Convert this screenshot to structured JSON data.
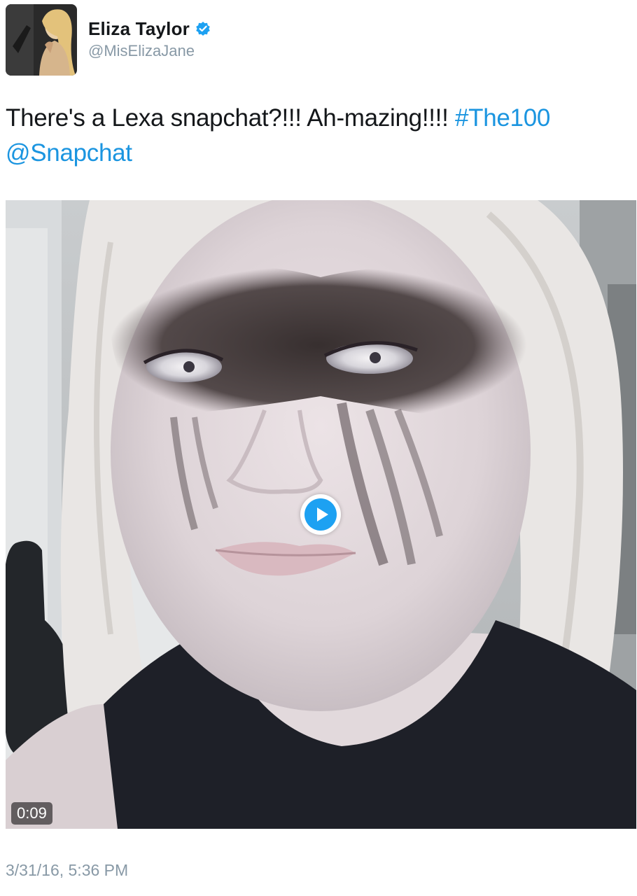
{
  "author": {
    "display_name": "Eliza Taylor",
    "handle": "@MisElizaJane",
    "verified_icon": "verified-badge-icon",
    "avatar_icon": "profile-avatar"
  },
  "tweet": {
    "text_plain": "There's a Lexa snapchat?!!! Ah-mazing!!!! ",
    "hashtag": "#The100",
    "mention": "@Snapchat",
    "timestamp": "3/31/16, 5:36 PM"
  },
  "media": {
    "type": "video",
    "duration": "0:09",
    "play_icon": "play-icon"
  },
  "colors": {
    "link": "#1b95e0",
    "verified": "#1da1f2",
    "secondary_text": "#8899a6",
    "primary_text": "#14171a"
  }
}
